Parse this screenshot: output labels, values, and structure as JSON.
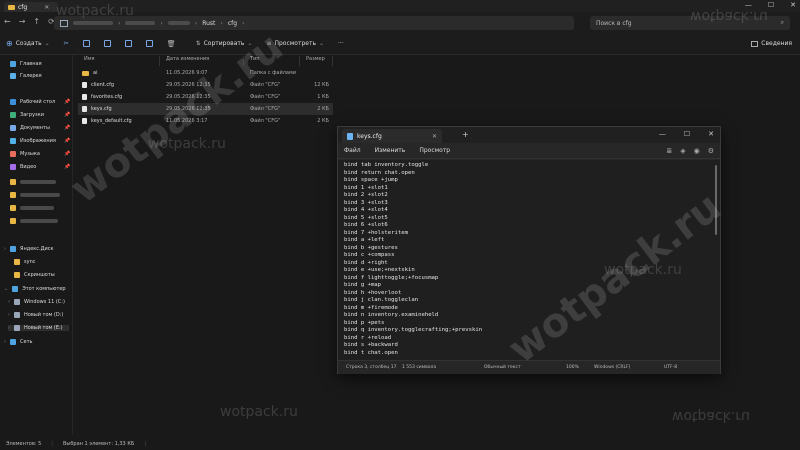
{
  "window": {
    "tab_title": "cfg",
    "controls": [
      "—",
      "☐",
      "✕"
    ]
  },
  "address": {
    "path": [
      "Rust",
      "cfg"
    ],
    "search_placeholder": "Поиск в cfg"
  },
  "toolbar": {
    "new_label": "Создать",
    "sort_label": "Сортировать",
    "view_label": "Просмотреть",
    "more_label": "···",
    "details_label": "Сведения"
  },
  "sidebar": {
    "quick": [
      {
        "label": "Главная",
        "icon": "home-icon",
        "color": "#4fa3e0"
      },
      {
        "label": "Галерея",
        "icon": "gallery-icon",
        "color": "#5bb0e8"
      }
    ],
    "pinned": [
      {
        "label": "Рабочий стол",
        "icon": "desktop-icon",
        "color": "#3c8fd8"
      },
      {
        "label": "Загрузки",
        "icon": "downloads-icon",
        "color": "#3fae7a"
      },
      {
        "label": "Документы",
        "icon": "documents-icon",
        "color": "#7aa7e8"
      },
      {
        "label": "Изображения",
        "icon": "pictures-icon",
        "color": "#4fb1e8"
      },
      {
        "label": "Музыка",
        "icon": "music-icon",
        "color": "#e86d5a"
      },
      {
        "label": "Видео",
        "icon": "videos-icon",
        "color": "#a56de8"
      }
    ],
    "tree": [
      {
        "label": "Яндекс.Диск",
        "icon": "yandex-disk-icon",
        "color": "#4fa3e0",
        "indent": 0
      },
      {
        "label": "sync",
        "icon": "folder-icon",
        "color": "#e8b645",
        "indent": 1
      },
      {
        "label": "Скриншоты",
        "icon": "folder-icon",
        "color": "#e8b645",
        "indent": 1
      },
      {
        "label": "Этот компьютер",
        "icon": "computer-icon",
        "color": "#4fa3e0",
        "indent": 0
      },
      {
        "label": "Windows 11 (C:)",
        "icon": "drive-icon",
        "color": "#9aa7b8",
        "indent": 1
      },
      {
        "label": "Новый том (D:)",
        "icon": "drive-icon",
        "color": "#9aa7b8",
        "indent": 1
      },
      {
        "label": "Новый том (E:)",
        "icon": "drive-icon",
        "color": "#9aa7b8",
        "indent": 1
      },
      {
        "label": "Сеть",
        "icon": "network-icon",
        "color": "#4fa3e0",
        "indent": 0
      }
    ]
  },
  "filelist": {
    "headers": [
      "Имя",
      "Дата изменения",
      "Тип",
      "Размер"
    ],
    "rows": [
      {
        "name": "ai",
        "date": "11.05.2026 9:07",
        "type": "Папка с файлами",
        "size": "",
        "kind": "folder"
      },
      {
        "name": "client.cfg",
        "date": "29.05.2026 12:35",
        "type": "Файл \"CFG\"",
        "size": "12 КБ",
        "kind": "file"
      },
      {
        "name": "favorites.cfg",
        "date": "29.05.2026 12:35",
        "type": "Файл \"CFG\"",
        "size": "1 КБ",
        "kind": "file"
      },
      {
        "name": "keys.cfg",
        "date": "29.05.2026 12:35",
        "type": "Файл \"CFG\"",
        "size": "2 КБ",
        "kind": "file",
        "selected": true
      },
      {
        "name": "keys_default.cfg",
        "date": "11.05.2026 3:17",
        "type": "Файл \"CFG\"",
        "size": "2 КБ",
        "kind": "file"
      }
    ]
  },
  "statusbar": {
    "items": "Элементов: 5",
    "selected": "Выбран 1 элемент: 1,33 КБ"
  },
  "notepad": {
    "tab_title": "keys.cfg",
    "new_tab": "+",
    "menu": [
      "Файл",
      "Изменить",
      "Просмотр"
    ],
    "lines": [
      "bind tab inventory.toggle",
      "bind return chat.open",
      "bind space +jump",
      "bind 1 +slot1",
      "bind 2 +slot2",
      "bind 3 +slot3",
      "bind 4 +slot4",
      "bind 5 +slot5",
      "bind 6 +slot6",
      "bind 7 +holsteritem",
      "bind a +left",
      "bind b +gestures",
      "bind c +compass",
      "bind d +right",
      "bind e +use;+nextskin",
      "bind f lighttoggle;+focusmap",
      "bind g +map",
      "bind h +hoverloot",
      "bind j clan.toggleclan",
      "bind m +firemode",
      "bind n inventory.examineheld",
      "bind p +pets",
      "bind q inventory.togglecrafting;+prevskin",
      "bind r +reload",
      "bind s +backward",
      "bind t chat.open"
    ],
    "status": {
      "position": "Строка 3, столбец 17",
      "chars": "1 553 символа",
      "format": "Обычный текст",
      "zoom": "100%",
      "eol": "Windows (CRLF)",
      "encoding": "UTF-8"
    }
  },
  "watermarks": {
    "big": "wotpack.ru",
    "small": "wotpack.ru",
    "mirrored": "wotpack.ru"
  }
}
